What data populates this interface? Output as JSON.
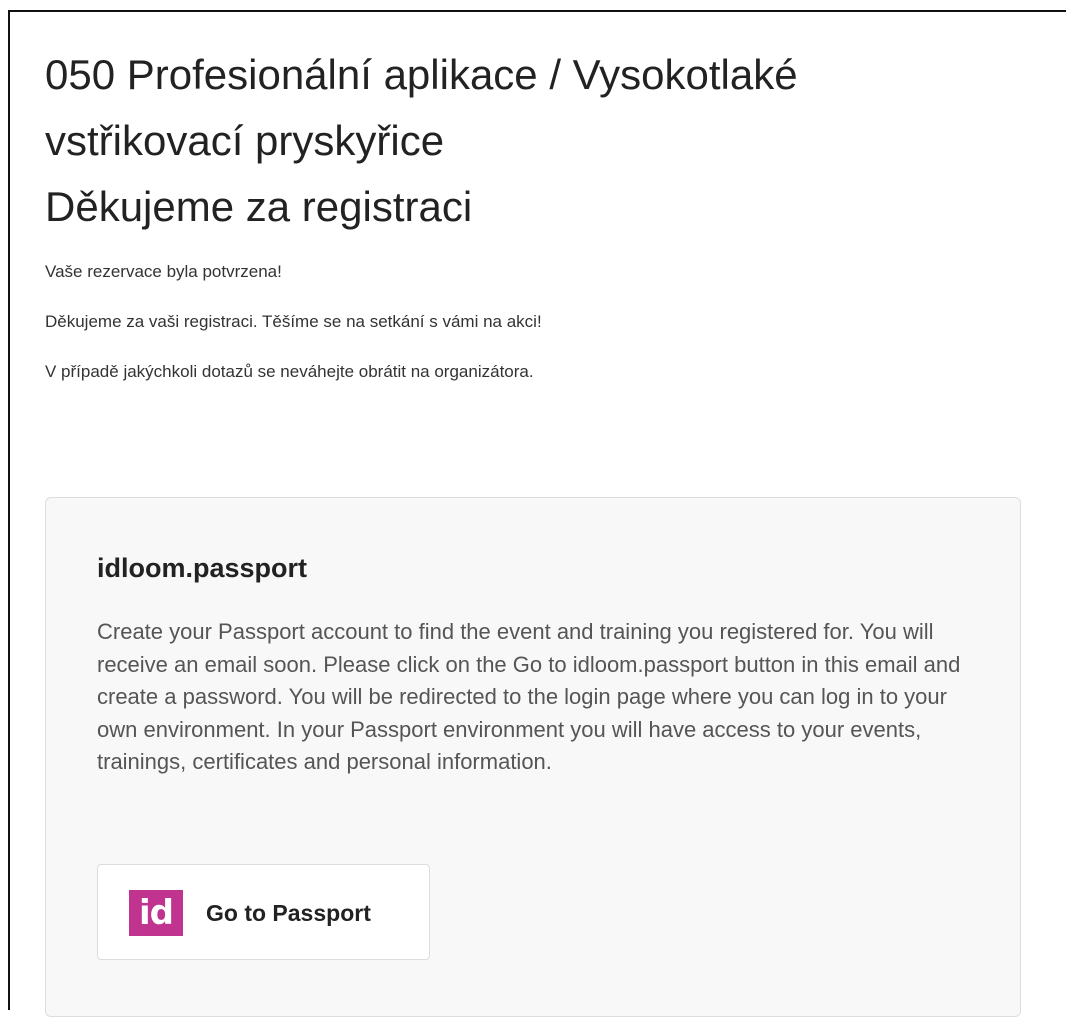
{
  "header": {
    "title_line1": "050 Profesionální aplikace / Vysokotlaké",
    "title_line2": "vstřikovací pryskyřice",
    "title_line3": "Děkujeme za registraci"
  },
  "messages": {
    "confirmation": "Vaše rezervace byla potvrzena!",
    "thanks": "Děkujeme za vaši registraci. Těšíme se na setkání s vámi na akci!",
    "contact": "V případě jakýchkoli dotazů se neváhejte obrátit na organizátora."
  },
  "passport": {
    "title": "idloom.passport",
    "description": "Create your Passport account to find the event and training you registered for. You will receive an email soon. Please click on the Go to idloom.passport button in this email and create a password. You will be redirected to the login page where you can log in to your own environment. In your Passport environment you will have access to your events, trainings, certificates and personal information.",
    "button_label": "Go to Passport",
    "logo_text": "id",
    "logo_icon": "idloom-logo-icon",
    "brand_color": "#c0348f"
  }
}
